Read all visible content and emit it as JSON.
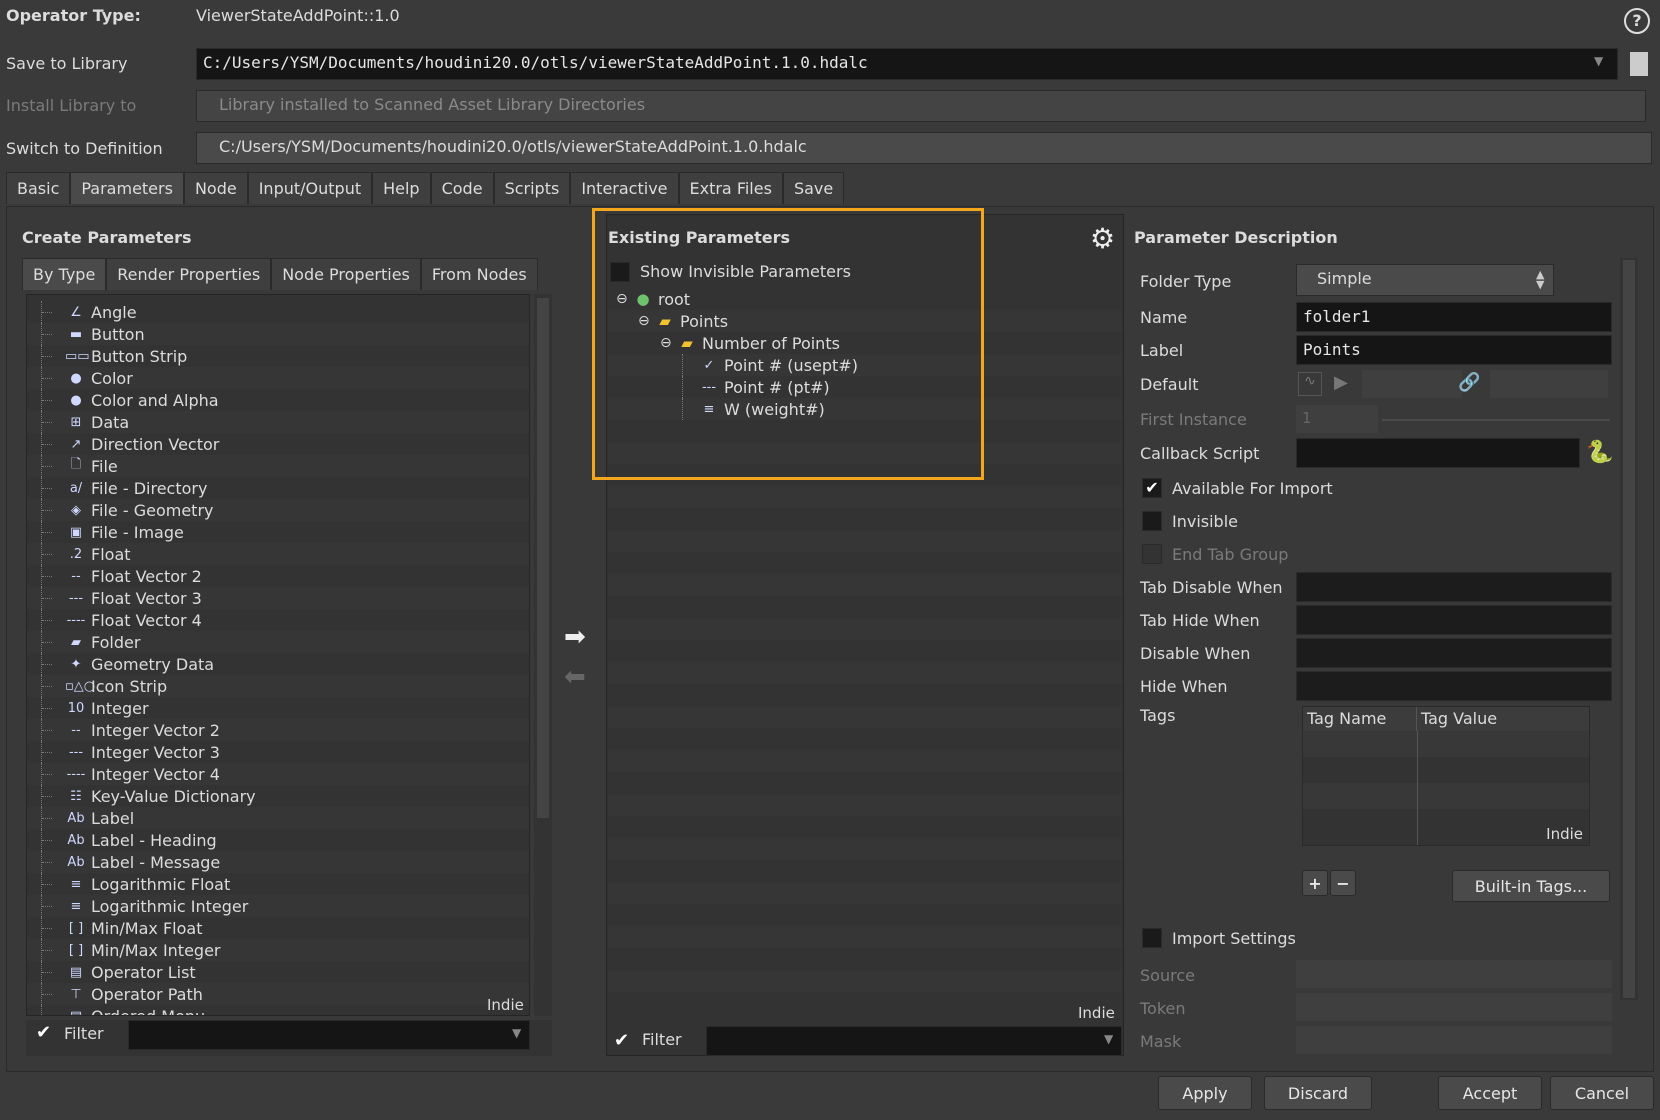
{
  "header": {
    "operator_type_label": "Operator Type:",
    "operator_type_value": "ViewerStateAddPoint::1.0",
    "save_to_library_label": "Save to Library",
    "save_to_library_value": "C:/Users/YSM/Documents/houdini20.0/otls/viewerStateAddPoint.1.0.hdalc",
    "install_library_label": "Install Library to",
    "install_library_value": "Library installed to Scanned Asset Library Directories",
    "switch_definition_label": "Switch to Definition",
    "switch_definition_value": "C:/Users/YSM/Documents/houdini20.0/otls/viewerStateAddPoint.1.0.hdalc",
    "help_icon": "?"
  },
  "main_tabs": [
    "Basic",
    "Parameters",
    "Node",
    "Input/Output",
    "Help",
    "Code",
    "Scripts",
    "Interactive",
    "Extra Files",
    "Save"
  ],
  "create_params": {
    "title": "Create Parameters",
    "tabs": [
      "By Type",
      "Render Properties",
      "Node Properties",
      "From Nodes"
    ],
    "items": [
      {
        "icon": "∠",
        "label": "Angle"
      },
      {
        "icon": "▬",
        "label": "Button"
      },
      {
        "icon": "▭▭",
        "label": "Button Strip"
      },
      {
        "icon": "●",
        "label": "Color"
      },
      {
        "icon": "●",
        "label": "Color and Alpha"
      },
      {
        "icon": "⊞",
        "label": "Data"
      },
      {
        "icon": "↗",
        "label": "Direction Vector"
      },
      {
        "icon": "🗋",
        "label": "File"
      },
      {
        "icon": "a/",
        "label": "File - Directory"
      },
      {
        "icon": "◈",
        "label": "File - Geometry"
      },
      {
        "icon": "▣",
        "label": "File - Image"
      },
      {
        "icon": ".2",
        "label": "Float"
      },
      {
        "icon": "--",
        "label": "Float Vector 2"
      },
      {
        "icon": "---",
        "label": "Float Vector 3"
      },
      {
        "icon": "----",
        "label": "Float Vector 4"
      },
      {
        "icon": "▰",
        "label": "Folder"
      },
      {
        "icon": "✦",
        "label": "Geometry Data"
      },
      {
        "icon": "▫△○",
        "label": "Icon Strip"
      },
      {
        "icon": "10",
        "label": "Integer"
      },
      {
        "icon": "--",
        "label": "Integer Vector 2"
      },
      {
        "icon": "---",
        "label": "Integer Vector 3"
      },
      {
        "icon": "----",
        "label": "Integer Vector 4"
      },
      {
        "icon": "☷",
        "label": "Key-Value Dictionary"
      },
      {
        "icon": "Ab",
        "label": "Label"
      },
      {
        "icon": "Ab",
        "label": "Label - Heading"
      },
      {
        "icon": "Ab",
        "label": "Label - Message"
      },
      {
        "icon": "≡",
        "label": "Logarithmic Float"
      },
      {
        "icon": "≡",
        "label": "Logarithmic Integer"
      },
      {
        "icon": "[ ]",
        "label": "Min/Max Float"
      },
      {
        "icon": "[ ]",
        "label": "Min/Max Integer"
      },
      {
        "icon": "▤",
        "label": "Operator List"
      },
      {
        "icon": "⊤",
        "label": "Operator Path"
      },
      {
        "icon": "▤",
        "label": "Ordered Menu"
      }
    ],
    "indie_label": "Indie",
    "filter_label": "Filter"
  },
  "existing_params": {
    "title": "Existing Parameters",
    "show_invisible_label": "Show Invisible Parameters",
    "tree": [
      {
        "label": "root",
        "level": 0
      },
      {
        "label": "Points",
        "level": 1
      },
      {
        "label": "Number of Points",
        "level": 2
      },
      {
        "label": "Point # (usept#)",
        "level": 3,
        "icon": "✓"
      },
      {
        "label": "Point # (pt#)",
        "level": 3,
        "icon": "---"
      },
      {
        "label": "W (weight#)",
        "level": 3,
        "icon": "≡"
      }
    ],
    "indie_label": "Indie",
    "filter_label": "Filter"
  },
  "param_desc": {
    "title": "Parameter Description",
    "folder_type_label": "Folder Type",
    "folder_type_value": "Simple",
    "name_label": "Name",
    "name_value": "folder1",
    "label_label": "Label",
    "label_value": "Points",
    "default_label": "Default",
    "first_instance_label": "First Instance",
    "first_instance_value": "1",
    "callback_label": "Callback Script",
    "available_import_label": "Available For Import",
    "invisible_label": "Invisible",
    "end_tab_group_label": "End Tab Group",
    "tab_disable_label": "Tab Disable When",
    "tab_hide_label": "Tab Hide When",
    "disable_when_label": "Disable When",
    "hide_when_label": "Hide When",
    "tags_label": "Tags",
    "tag_name_header": "Tag Name",
    "tag_value_header": "Tag Value",
    "indie_label": "Indie",
    "plus_label": "+",
    "minus_label": "−",
    "builtin_tags_label": "Built-in Tags...",
    "import_settings_label": "Import Settings",
    "source_label": "Source",
    "token_label": "Token",
    "mask_label": "Mask"
  },
  "footer": {
    "apply": "Apply",
    "discard": "Discard",
    "accept": "Accept",
    "cancel": "Cancel"
  }
}
